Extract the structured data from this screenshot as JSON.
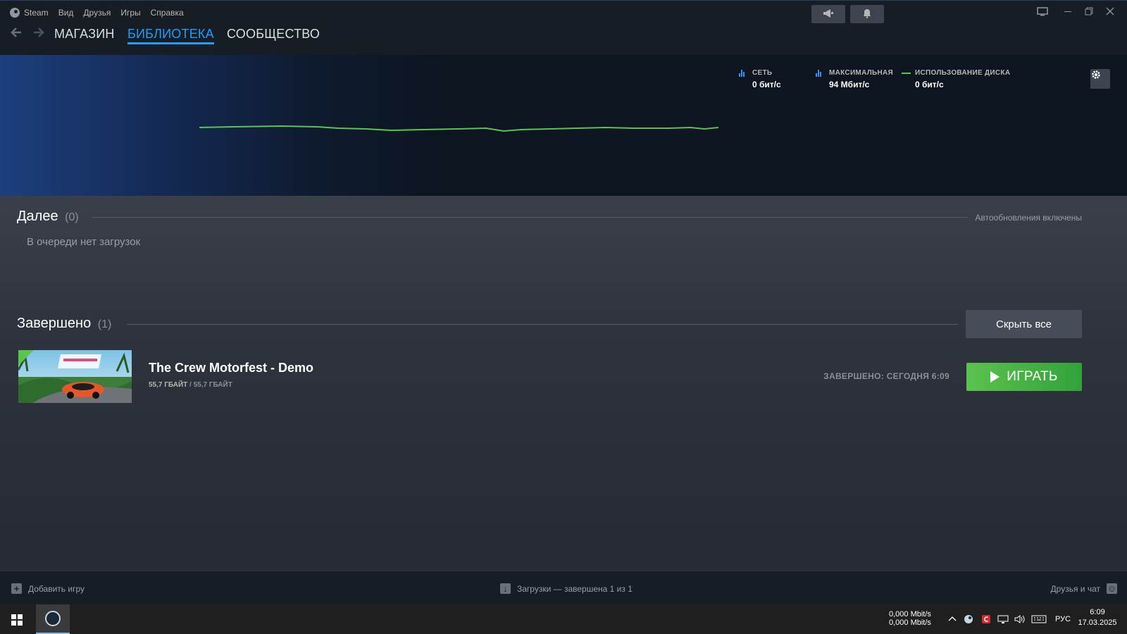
{
  "titlebar": {
    "app_name": "Steam",
    "menu": [
      "Вид",
      "Друзья",
      "Игры",
      "Справка"
    ]
  },
  "nav": {
    "tabs": [
      {
        "label": "МАГАЗИН",
        "active": false
      },
      {
        "label": "БИБЛИОТЕКА",
        "active": true
      },
      {
        "label": "СООБЩЕСТВО",
        "active": false
      }
    ]
  },
  "stats": {
    "network": {
      "label": "СЕТЬ",
      "value": "0 бит/с"
    },
    "peak": {
      "label": "МАКСИМАЛЬНАЯ",
      "value": "94 Мбит/с"
    },
    "disk": {
      "label": "ИСПОЛЬЗОВАНИЕ ДИСКА",
      "value": "0 бит/с"
    }
  },
  "queue": {
    "title": "Далее",
    "count": "(0)",
    "auto_updates": "Автообновления включены",
    "empty_text": "В очереди нет загрузок"
  },
  "completed": {
    "title": "Завершено",
    "count": "(1)",
    "hide_all": "Скрыть все",
    "items": [
      {
        "name": "The Crew Motorfest - Demo",
        "downloaded": "55,7 ГБАЙТ",
        "separator": "/",
        "total": "55,7 ГБАЙТ",
        "status": "ЗАВЕРШЕНО: СЕГОДНЯ 6:09",
        "play_label": "ИГРАТЬ"
      }
    ]
  },
  "bottombar": {
    "add_game": "Добавить игру",
    "downloads": "Загрузки — завершена 1 из 1",
    "friends": "Друзья и чат"
  },
  "taskbar": {
    "net_up": "0,000 Mbit/s",
    "net_down": "0,000 Mbit/s",
    "lang": "РУС",
    "time": "6:09",
    "date": "17.03.2025"
  },
  "colors": {
    "accent": "#1a9fff",
    "play_green": "#5cc24e",
    "graph_line": "#5ac54e"
  }
}
